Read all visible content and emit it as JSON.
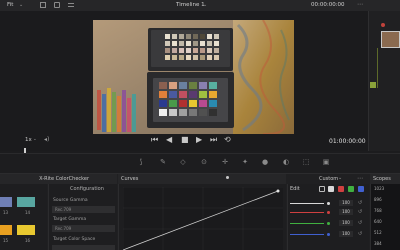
{
  "topbar": {
    "fit_label": "Fit",
    "fit_chevron": "⌄",
    "timeline_name": "Timeline 1",
    "timeline_chevron": "⌄",
    "timecode": "00:00:00:00",
    "timecode_chevron": "⌄",
    "menu_glyph": "⋯"
  },
  "viewer": {
    "zoom_label": "1x",
    "zoom_chevron": "⌄",
    "timecode": "01:00:00:00",
    "transport_icons": [
      "skip-back-icon",
      "rewind-icon",
      "stop-icon",
      "play-icon",
      "skip-forward-icon",
      "loop-icon"
    ]
  },
  "toolbar": {
    "tools": [
      "curves-tool-icon",
      "eyedropper-icon",
      "qualifier-icon",
      "window-icon",
      "tracker-icon",
      "magic-mask-icon",
      "blur-icon",
      "key-icon",
      "sizing-icon",
      "3d-icon"
    ]
  },
  "colorchecker": {
    "title": "X-Rite ColorChecker",
    "swatches": [
      {
        "color": "#6f7fb5",
        "label": "13"
      },
      {
        "color": "#58a6a0",
        "label": "14"
      },
      {
        "color": "#e8a020",
        "label": "15"
      },
      {
        "color": "#e8c830",
        "label": "16"
      }
    ]
  },
  "configuration": {
    "title": "Configuration",
    "source_gamma_label": "Source Gamma",
    "source_gamma_value": "Rec.709",
    "target_gamma_label": "Target Gamma",
    "target_gamma_value": "Rec.709",
    "target_color_space_label": "Target Color Space"
  },
  "curves": {
    "title": "Curves",
    "mode": "Custom",
    "mode_chevron": "⌄"
  },
  "edit": {
    "title": "Edit",
    "channels": [
      {
        "color": "#d8d8d8",
        "value": "100"
      },
      {
        "color": "#d04040",
        "value": "100"
      },
      {
        "color": "#40b040",
        "value": "100"
      },
      {
        "color": "#4060d0",
        "value": "100"
      }
    ],
    "channel_buttons": [
      "#d8d8d8",
      "#d04040",
      "#40b040",
      "#4060d0"
    ]
  },
  "scopes": {
    "title": "Scopes",
    "values": [
      "1023",
      "896",
      "768",
      "640",
      "512",
      "384"
    ]
  }
}
